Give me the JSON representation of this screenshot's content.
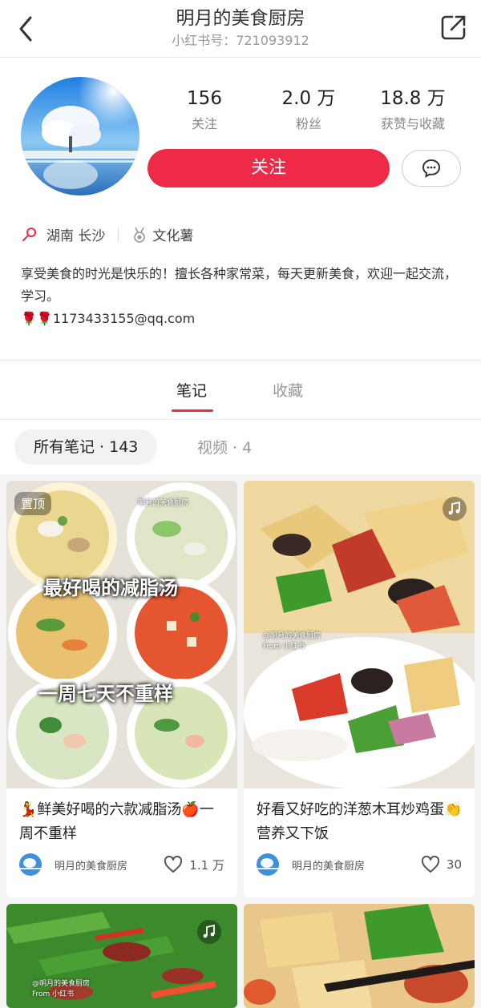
{
  "header": {
    "title": "明月的美食厨房",
    "subtitle": "小红书号：721093912"
  },
  "profile": {
    "stats": [
      {
        "value": "156",
        "label": "关注"
      },
      {
        "value": "2.0 万",
        "label": "粉丝"
      },
      {
        "value": "18.8 万",
        "label": "获赞与收藏"
      }
    ],
    "follow_label": "关注",
    "location": "湖南 长沙",
    "badge": "文化薯",
    "bio_line1": "享受美食的时光是快乐的！擅长各种家常菜，每天更新美食，欢迎一起交流，学习。",
    "bio_contact": "🌹🌹1173433155@qq.com"
  },
  "tabs": {
    "notes": "笔记",
    "favorites": "收藏"
  },
  "subtabs": {
    "all_notes": "所有笔记 · 143",
    "videos": "视频 · 4"
  },
  "cards": [
    {
      "pin": "置顶",
      "overlay_top": "最好喝的减脂汤",
      "overlay_bottom": "一周七天不重样",
      "watermark": "明月的美食厨房",
      "title": "💃鲜美好喝的六款减脂汤🍎一周不重样",
      "author": "明月的美食厨房",
      "likes": "1.1 万"
    },
    {
      "watermark": "@明月的美食厨房\nFrom 小红书",
      "title": "好看又好吃的洋葱木耳炒鸡蛋👏营养又下饭",
      "author": "明月的美食厨房",
      "likes": "30"
    },
    {
      "watermark": "@明月的美食厨房\nFrom 小红书"
    },
    {}
  ],
  "colors": {
    "accent": "#ef2a48",
    "text_primary": "#222222",
    "text_secondary": "#999999",
    "background": "#f4f4f4"
  },
  "icons": {
    "back": "chevron-left-icon",
    "share": "share-icon",
    "message": "chat-bubble-icon",
    "location": "location-pin-icon",
    "badge": "medal-icon",
    "like": "heart-icon",
    "music": "music-note-icon"
  }
}
